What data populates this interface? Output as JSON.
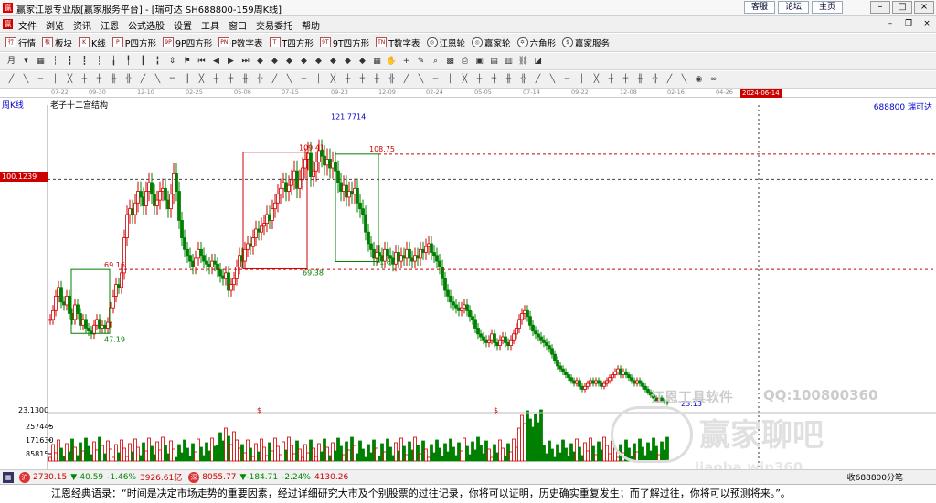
{
  "window": {
    "title": "赢家江恩专业版[赢家服务平台] - [瑞可达  SH688800-159周K线]",
    "links": [
      "客服",
      "论坛",
      "主页"
    ]
  },
  "menu": [
    "文件",
    "浏览",
    "资讯",
    "江恩",
    "公式选股",
    "设置",
    "工具",
    "窗口",
    "交易委托",
    "帮助"
  ],
  "toolbar": {
    "items": [
      {
        "icon": "行",
        "label": "行情"
      },
      {
        "icon": "板",
        "label": "板块"
      },
      {
        "icon": "K",
        "label": "K线"
      },
      {
        "icon": "P",
        "label": "P四方形"
      },
      {
        "icon": "9P",
        "label": "9P四方形"
      },
      {
        "icon": "PN",
        "label": "P数字表"
      },
      {
        "icon": "T",
        "label": "T四方形"
      },
      {
        "icon": "9T",
        "label": "9T四方形"
      },
      {
        "icon": "TN",
        "label": "T数字表"
      },
      {
        "icon": "◎",
        "label": "江恩轮"
      },
      {
        "icon": "◎",
        "label": "赢家轮"
      },
      {
        "icon": "✡",
        "label": "六角形"
      },
      {
        "icon": "$",
        "label": "赢家服务"
      }
    ]
  },
  "chart": {
    "period": "周K线",
    "indicator": "老子十二宫结构",
    "code": "688800  瑞可达",
    "cursor_price": "100.1239",
    "cursor_date": "2024-06-14",
    "timescale_labels": [
      "07-22",
      "09-30",
      "12-10",
      "02-25",
      "05-06",
      "07-15",
      "09-23",
      "12-09",
      "02-24",
      "05-05",
      "07-14",
      "09-22",
      "12-08",
      "02-16",
      "04-26"
    ],
    "volume_ticks": [
      "23.1300",
      "257445",
      "171630",
      "85815"
    ]
  },
  "chart_data": {
    "type": "candlestick",
    "title": "老子十二宫结构",
    "symbol": "688800 瑞可达",
    "period": "周K线",
    "candles_summary": {
      "high": 121.7714,
      "low": 23.13,
      "annotated_levels": [
        121.7714,
        109.41,
        108.75,
        69.16,
        69.38,
        71.87,
        47.19,
        23.13
      ]
    },
    "boxes": [
      {
        "color": "green",
        "low": 47.19,
        "high": 69.16
      },
      {
        "color": "red",
        "low": 69.38,
        "high": 109.41
      },
      {
        "color": "green",
        "low": 71.87,
        "high": 108.75
      }
    ],
    "volume_axis": [
      85815,
      171630,
      257445
    ]
  },
  "status": {
    "sh": {
      "value": "2730.15",
      "change": "▼-40.59",
      "pct": "-1.46%",
      "amount": "3926.61亿"
    },
    "sz": {
      "value": "8055.77",
      "change": "▼-184.71",
      "pct": "-2.24%",
      "amount": "4130.26"
    },
    "right": "收688800分笔"
  },
  "quote": "江恩经典语录：“时间是决定市场走势的重要因素，经过详细研究大市及个别股票的过往记录，你将可以证明，历史确实重复发生；而了解过往，你将可以预测将来。”。",
  "watermark": {
    "line1": "江恩工具软件",
    "line2": "QQ:100800360",
    "line3": "赢家聊吧",
    "line4": "liaoba.win360"
  },
  "colors": {
    "up": "#d00000",
    "down": "#008000",
    "cursor": "#c00000",
    "link": "#0000c0"
  }
}
